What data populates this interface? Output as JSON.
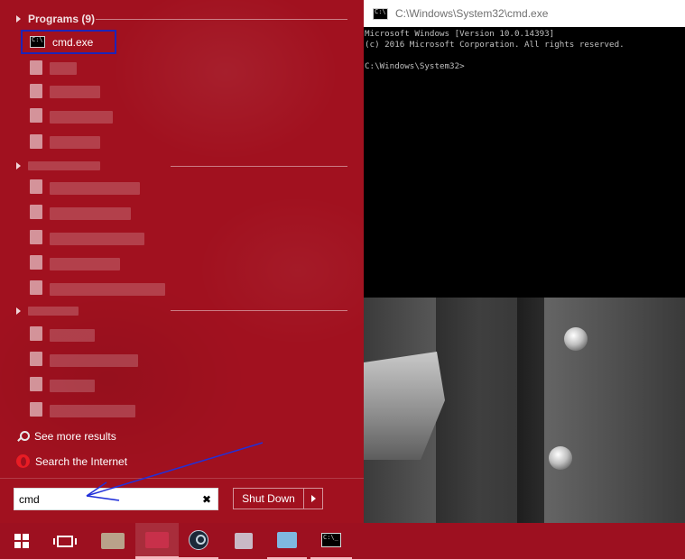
{
  "start_menu": {
    "programs_header": "Programs (9)",
    "top_result": {
      "label": "cmd.exe",
      "icon": "command-prompt-icon"
    },
    "see_more_label": "See more results",
    "search_internet_label": "Search the Internet",
    "search": {
      "value": "cmd",
      "clear_glyph": "✖"
    },
    "shutdown_label": "Shut Down",
    "accent_color": "#a1111f",
    "highlight_color": "#1d24b8"
  },
  "cmd_window": {
    "title": "C:\\Windows\\System32\\cmd.exe",
    "output": "Microsoft Windows [Version 10.0.14393]\n(c) 2016 Microsoft Corporation. All rights reserved.\n\nC:\\Windows\\System32>"
  },
  "taskbar": {
    "color": "#9d1020",
    "items": [
      "windows-start-icon",
      "task-view-icon",
      "blurred-app-icon",
      "blurred-app-icon",
      "steam-icon",
      "blurred-app-icon",
      "blurred-app-icon",
      "command-prompt-icon"
    ]
  }
}
